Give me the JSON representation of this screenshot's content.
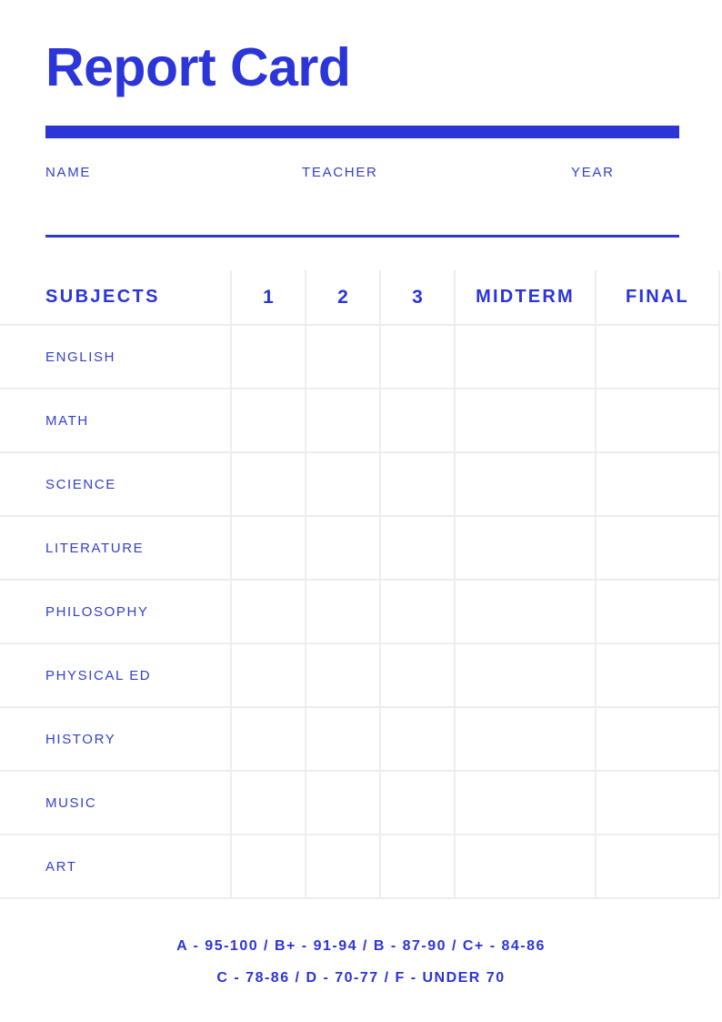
{
  "document": {
    "title": "Report Card",
    "accent_color": "#2B35D8",
    "text_color": "#3341CB",
    "grid_color": "#EDEDEF",
    "background_color": "#FFFFFF"
  },
  "meta_fields": {
    "name_label": "NAME",
    "teacher_label": "TEACHER",
    "year_label": "YEAR",
    "name_value": "",
    "teacher_value": "",
    "year_value": ""
  },
  "table": {
    "headers": {
      "subjects": "SUBJECTS",
      "q1": "1",
      "q2": "2",
      "q3": "3",
      "midterm": "MIDTERM",
      "final": "FINAL"
    },
    "rows": [
      {
        "subject": "ENGLISH",
        "q1": "",
        "q2": "",
        "q3": "",
        "midterm": "",
        "final": ""
      },
      {
        "subject": "MATH",
        "q1": "",
        "q2": "",
        "q3": "",
        "midterm": "",
        "final": ""
      },
      {
        "subject": "SCIENCE",
        "q1": "",
        "q2": "",
        "q3": "",
        "midterm": "",
        "final": ""
      },
      {
        "subject": "LITERATURE",
        "q1": "",
        "q2": "",
        "q3": "",
        "midterm": "",
        "final": ""
      },
      {
        "subject": "PHILOSOPHY",
        "q1": "",
        "q2": "",
        "q3": "",
        "midterm": "",
        "final": ""
      },
      {
        "subject": "PHYSICAL ED",
        "q1": "",
        "q2": "",
        "q3": "",
        "midterm": "",
        "final": ""
      },
      {
        "subject": "HISTORY",
        "q1": "",
        "q2": "",
        "q3": "",
        "midterm": "",
        "final": ""
      },
      {
        "subject": "MUSIC",
        "q1": "",
        "q2": "",
        "q3": "",
        "midterm": "",
        "final": ""
      },
      {
        "subject": "ART",
        "q1": "",
        "q2": "",
        "q3": "",
        "midterm": "",
        "final": ""
      }
    ]
  },
  "grading_scale": {
    "line1": "A - 95-100  /  B+ - 91-94  /  B - 87-90  /  C+ - 84-86",
    "line2": "C - 78-86  /  D - 70-77  /  F - UNDER 70"
  }
}
